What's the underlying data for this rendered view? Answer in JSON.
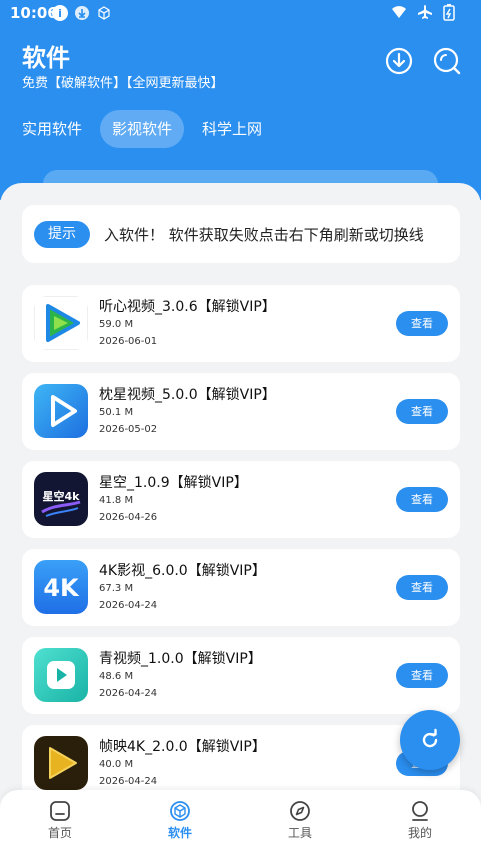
{
  "status_bar": {
    "time": "10:06"
  },
  "header": {
    "title": "软件",
    "subtitle": "免费【破解软件】【全网更新最快】"
  },
  "tabs": [
    {
      "label": "实用软件",
      "active": false
    },
    {
      "label": "影视软件",
      "active": true
    },
    {
      "label": "科学上网",
      "active": false
    }
  ],
  "notice": {
    "tag": "提示",
    "text": "入软件！   软件获取失败点击右下角刷新或切换线"
  },
  "apps": [
    {
      "name": "听心视频_3.0.6【解锁VIP】",
      "size": "59.0 M",
      "date": "2026-06-01",
      "button": "查看",
      "icon": "tingxin-icon"
    },
    {
      "name": "枕星视频_5.0.0【解锁VIP】",
      "size": "50.1 M",
      "date": "2026-05-02",
      "button": "查看",
      "icon": "zhenxing-icon"
    },
    {
      "name": "星空_1.0.9【解锁VIP】",
      "size": "41.8 M",
      "date": "2026-04-26",
      "button": "查看",
      "icon": "xingkong-icon"
    },
    {
      "name": "4K影视_6.0.0【解锁VIP】",
      "size": "67.3 M",
      "date": "2026-04-24",
      "button": "查看",
      "icon": "4k-icon"
    },
    {
      "name": "青视频_1.0.0【解锁VIP】",
      "size": "48.6 M",
      "date": "2026-04-24",
      "button": "查看",
      "icon": "qing-icon"
    },
    {
      "name": "帧映4K_2.0.0【解锁VIP】",
      "size": "40.0 M",
      "date": "2026-04-24",
      "button": "查看",
      "icon": "zhenying-icon"
    }
  ],
  "icon_labels": {
    "xingkong": "星空4k",
    "fourk": "4K"
  },
  "bottom_nav": [
    {
      "label": "首页",
      "icon": "home-icon",
      "active": false
    },
    {
      "label": "软件",
      "icon": "box-icon",
      "active": true
    },
    {
      "label": "工具",
      "icon": "compass-icon",
      "active": false
    },
    {
      "label": "我的",
      "icon": "profile-icon",
      "active": false
    }
  ],
  "colors": {
    "accent": "#2b8ff0",
    "background": "#f2f3f5"
  }
}
